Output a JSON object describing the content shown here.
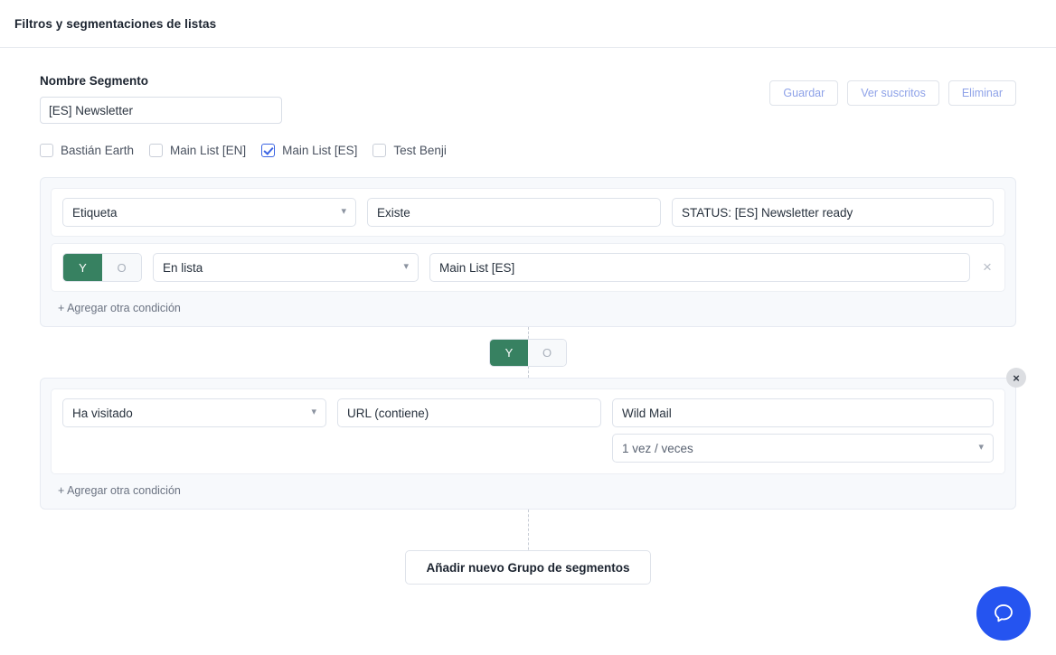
{
  "topbar": {
    "title": "Filtros y segmentaciones de listas"
  },
  "segment": {
    "label": "Nombre Segmento",
    "name_value": "[ES] Newsletter",
    "name_placeholder": "Nombre Segmento"
  },
  "actions": {
    "save": "Guardar",
    "view_subscribers": "Ver suscritos",
    "delete": "Eliminar"
  },
  "lists": [
    {
      "label": "Bastián Earth",
      "checked": false
    },
    {
      "label": "Main List [EN]",
      "checked": false
    },
    {
      "label": "Main List [ES]",
      "checked": true
    },
    {
      "label": "Test Benji",
      "checked": false
    }
  ],
  "toggle": {
    "and": "Y",
    "or": "O"
  },
  "group_toggle": {
    "and": "Y",
    "or": "O",
    "selected": "Y"
  },
  "groups": [
    {
      "conditions": [
        {
          "type": "Etiqueta",
          "operator": "Existe",
          "value": "STATUS: [ES] Newsletter ready",
          "has_toggle": false,
          "has_remove": false
        },
        {
          "toggle_selected": "Y",
          "type": "En lista",
          "value": "Main List [ES]",
          "has_toggle": true,
          "has_remove": true
        }
      ],
      "add_condition": "+ Agregar otra condición",
      "removable": false
    },
    {
      "conditions": [
        {
          "type": "Ha visitado",
          "operator": "URL (contiene)",
          "value": "Wild Mail",
          "frequency": "1 vez / veces",
          "has_toggle": false,
          "has_remove": false
        }
      ],
      "add_condition": "+ Agregar otra condición",
      "removable": true
    }
  ],
  "footer": {
    "add_group": "Añadir nuevo Grupo de segmentos"
  },
  "help": {
    "icon": "chat-bubble-icon",
    "color": "#2554f0"
  },
  "icons": {
    "close": "×",
    "chevron_down": "⌄"
  }
}
